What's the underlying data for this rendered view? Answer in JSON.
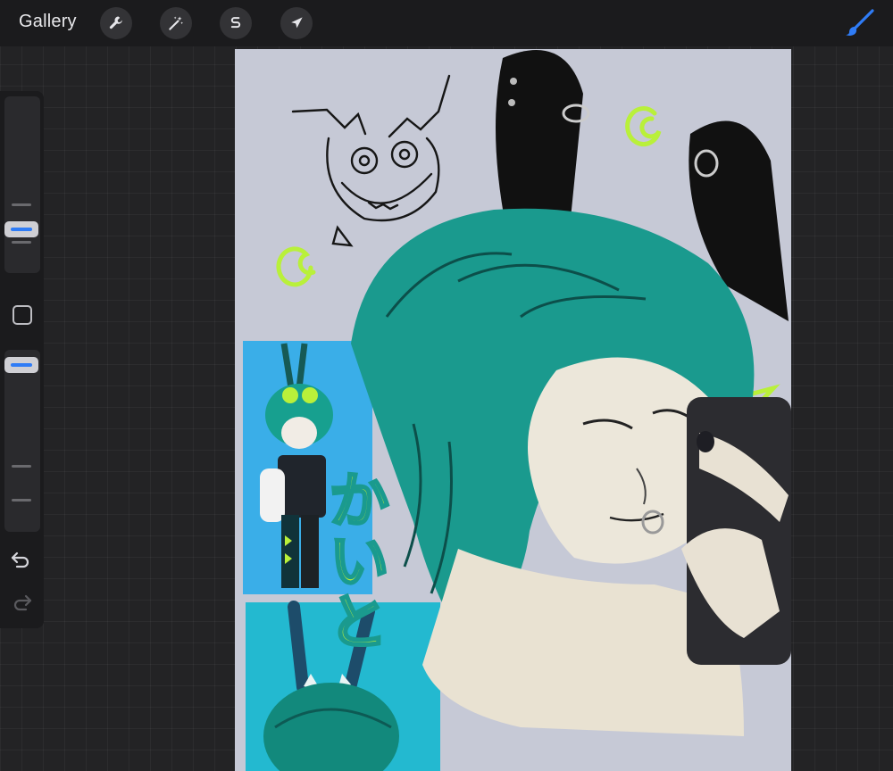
{
  "toolbar": {
    "gallery_label": "Gallery",
    "tools": [
      {
        "name": "actions",
        "icon": "wrench-icon"
      },
      {
        "name": "adjustments",
        "icon": "magic-wand-icon"
      },
      {
        "name": "selection",
        "icon": "selection-s-icon"
      },
      {
        "name": "transform",
        "icon": "arrow-cursor-icon"
      }
    ],
    "brush_icon": "paintbrush-icon",
    "accent_color": "#2f7cf6"
  },
  "sidebar": {
    "brush_size_slider": {
      "icon": "slider-thumb",
      "level": 0.55
    },
    "modify_button_icon": "square-icon",
    "opacity_slider": {
      "icon": "slider-thumb",
      "level": 0.95
    },
    "undo_icon": "undo-arrow-icon",
    "redo_icon": "redo-arrow-icon"
  },
  "canvas": {
    "background_color": "#c6c9d6",
    "hair_color": "#1a9a8e",
    "accent_green": "#b9f03a",
    "reference_bg_color": "#3aaee8",
    "japanese_text": "かいと"
  }
}
